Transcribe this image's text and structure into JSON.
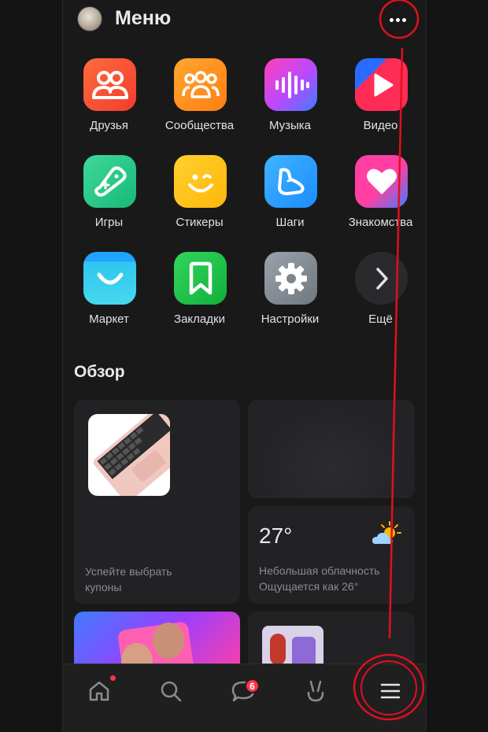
{
  "header": {
    "title": "Меню"
  },
  "apps": [
    {
      "label": "Друзья",
      "icon": "friends-icon"
    },
    {
      "label": "Сообщества",
      "icon": "communities-icon"
    },
    {
      "label": "Музыка",
      "icon": "music-icon"
    },
    {
      "label": "Видео",
      "icon": "video-icon"
    },
    {
      "label": "Игры",
      "icon": "games-icon"
    },
    {
      "label": "Стикеры",
      "icon": "stickers-icon"
    },
    {
      "label": "Шаги",
      "icon": "steps-icon"
    },
    {
      "label": "Знакомства",
      "icon": "dating-icon"
    },
    {
      "label": "Маркет",
      "icon": "market-icon"
    },
    {
      "label": "Закладки",
      "icon": "bookmarks-icon"
    },
    {
      "label": "Настройки",
      "icon": "settings-icon"
    },
    {
      "label": "Ещё",
      "icon": "chevron-right-icon"
    }
  ],
  "overview": {
    "title": "Обзор",
    "coupons_line1": "Успейте выбрать",
    "coupons_line2": "купоны",
    "weather": {
      "temp": "27°",
      "desc_line1": "Небольшая облачность",
      "desc_line2": "Ощущается как 26°"
    }
  },
  "tabbar": {
    "messages_badge": "6",
    "tabs": [
      "home-icon",
      "search-icon",
      "messages-icon",
      "clips-icon",
      "menu-icon"
    ]
  },
  "colors": {
    "background": "#19191a",
    "annotation": "#e0101e",
    "badge": "#ff3347"
  }
}
